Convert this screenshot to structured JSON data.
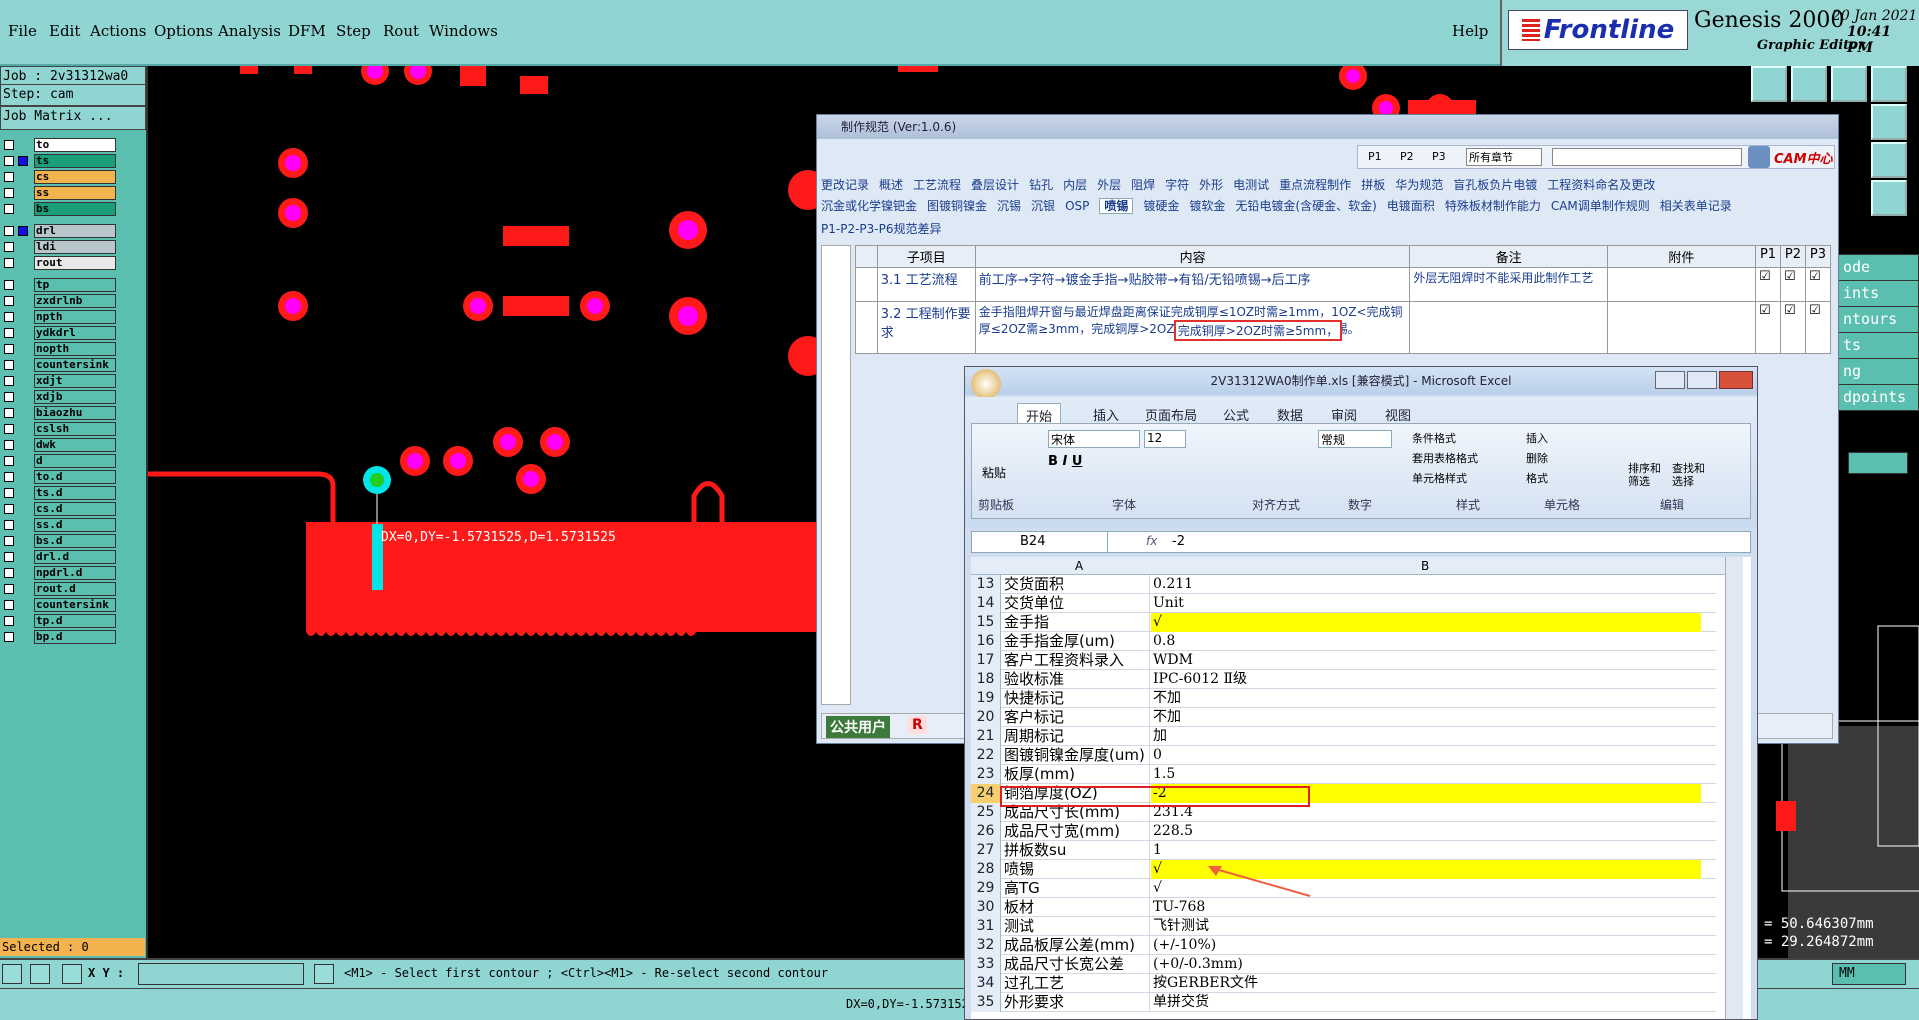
{
  "menu": {
    "items": [
      "File",
      "Edit",
      "Actions",
      "Options",
      "Analysis",
      "DFM",
      "Step",
      "Rout",
      "Windows"
    ],
    "help": "Help"
  },
  "brand": {
    "logo": "Frontline",
    "product": "Genesis 2000",
    "subtitle": "Graphic Editor",
    "date": "20 Jan 2021",
    "time": "10:41 PM"
  },
  "left": {
    "job": "Job : 2v31312wa0",
    "step": "Step: cam",
    "matrix": "Job Matrix ...",
    "layers": [
      {
        "name": "to",
        "color": "#ffffff",
        "marked": false
      },
      {
        "name": "ts",
        "color": "#1a9f7a",
        "marked": true
      },
      {
        "name": "cs",
        "color": "#f2b24e",
        "marked": false
      },
      {
        "name": "ss",
        "color": "#f2b24e",
        "marked": false
      },
      {
        "name": "bs",
        "color": "#1a9f7a",
        "marked": false
      },
      {
        "name": "drl",
        "color": "#b8c6cc",
        "marked": true
      },
      {
        "name": "ldi",
        "color": "#b8c6cc",
        "marked": false
      },
      {
        "name": "rout",
        "color": "#e8e8e8",
        "marked": false
      },
      {
        "name": "tp",
        "color": "#5bbfb0",
        "marked": false
      },
      {
        "name": "zxdrlnb",
        "color": "#5bbfb0",
        "marked": false
      },
      {
        "name": "npth",
        "color": "#5bbfb0",
        "marked": false
      },
      {
        "name": "ydkdrl",
        "color": "#5bbfb0",
        "marked": false
      },
      {
        "name": "nopth",
        "color": "#5bbfb0",
        "marked": false
      },
      {
        "name": "countersink",
        "color": "#5bbfb0",
        "marked": false
      },
      {
        "name": "xdjt",
        "color": "#5bbfb0",
        "marked": false
      },
      {
        "name": "xdjb",
        "color": "#5bbfb0",
        "marked": false
      },
      {
        "name": "biaozhu",
        "color": "#5bbfb0",
        "marked": false
      },
      {
        "name": "cslsh",
        "color": "#5bbfb0",
        "marked": false
      },
      {
        "name": "dwk",
        "color": "#5bbfb0",
        "marked": false
      },
      {
        "name": "d",
        "color": "#5bbfb0",
        "marked": false
      },
      {
        "name": "to.d",
        "color": "#5bbfb0",
        "marked": false
      },
      {
        "name": "ts.d",
        "color": "#5bbfb0",
        "marked": false
      },
      {
        "name": "cs.d",
        "color": "#5bbfb0",
        "marked": false
      },
      {
        "name": "ss.d",
        "color": "#5bbfb0",
        "marked": false
      },
      {
        "name": "bs.d",
        "color": "#5bbfb0",
        "marked": false
      },
      {
        "name": "drl.d",
        "color": "#5bbfb0",
        "marked": false
      },
      {
        "name": "npdrl.d",
        "color": "#5bbfb0",
        "marked": false
      },
      {
        "name": "rout.d",
        "color": "#5bbfb0",
        "marked": false
      },
      {
        "name": "countersink",
        "color": "#5bbfb0",
        "marked": false
      },
      {
        "name": "tp.d",
        "color": "#5bbfb0",
        "marked": false
      },
      {
        "name": "bp.d",
        "color": "#5bbfb0",
        "marked": false
      }
    ],
    "selected": "Selected : 0"
  },
  "canvas": {
    "measure": "DX=0,DY=-1.5731525,D=1.5731525"
  },
  "right": {
    "list": [
      "ode",
      "ints",
      "ntours",
      "ts",
      "ng",
      "dpoints"
    ],
    "coord_x": "= 50.646307mm",
    "coord_y": "= 29.264872mm",
    "units": "MM"
  },
  "bottom": {
    "xy_label": "X Y :",
    "hint": "<M1> - Select first contour ; <Ctrl><M1> - Re-select second contour",
    "status": "DX=0,DY=-1.573152"
  },
  "spec": {
    "title": "制作规范 (Ver:1.0.6)",
    "filters": [
      "P1",
      "P2",
      "P3"
    ],
    "section_select": "所有章节",
    "cam_logo": "CAM中心",
    "tabs_row1": [
      "更改记录",
      "概述",
      "工艺流程",
      "叠层设计",
      "钻孔",
      "内层",
      "外层",
      "阻焊",
      "字符",
      "外形",
      "电测试",
      "重点流程制作",
      "拼板",
      "华为规范",
      "盲孔板负片电镀",
      "工程资料命名及更改"
    ],
    "tabs_row2": [
      "沉金或化学镍钯金",
      "图镀铜镍金",
      "沉锡",
      "沉银",
      "OSP",
      "喷锡",
      "镀硬金",
      "镀软金",
      "无铅电镀金(含硬金、软金)",
      "电镀面积",
      "特殊板材制作能力",
      "CAM调单制作规则",
      "相关表单记录"
    ],
    "tabs_row3": "P1-P2-P3-P6规范差异",
    "headers": [
      "子项目",
      "内容",
      "备注",
      "附件",
      "P1",
      "P2",
      "P3"
    ],
    "rows": [
      {
        "item": "3.1 工艺流程",
        "content": "前工序→字符→镀金手指→贴胶带→有铅/无铅喷锡→后工序",
        "note": "外层无阻焊时不能采用此制作工艺"
      },
      {
        "item": "3.2 工程制作要求",
        "content": "金手指阻焊开窗与最近焊盘距离保证完成铜厚≤1OZ时需≥1mm，1OZ<完成铜厚≤2OZ需≥3mm，完成铜厚>2OZ时需≥5mm，以防止金手指上锡。",
        "highlight": "完成铜厚>2OZ时需≥5mm，",
        "note": ""
      }
    ],
    "user": "公共用户",
    "user_tag": "R"
  },
  "excel": {
    "title": "2V31312WA0制作单.xls  [兼容模式] - Microsoft Excel",
    "tabs": [
      "开始",
      "插入",
      "页面布局",
      "公式",
      "数据",
      "审阅",
      "视图"
    ],
    "font": "宋体",
    "size": "12",
    "numfmt": "常规",
    "groups": [
      "剪贴板",
      "字体",
      "对齐方式",
      "数字",
      "样式",
      "单元格",
      "编辑"
    ],
    "buttons": {
      "paste": "粘贴",
      "cond": "条件格式",
      "table": "套用表格格式",
      "cellstyle": "单元格样式",
      "insert": "插入",
      "delete": "删除",
      "format": "格式",
      "sort": "排序和\n筛选",
      "find": "查找和\n选择"
    },
    "cellref": "B24",
    "formula": "-2",
    "col_a": "A",
    "col_b": "B",
    "rows": [
      {
        "n": "13",
        "a": "交货面积",
        "b": "0.211",
        "y": false
      },
      {
        "n": "14",
        "a": "交货单位",
        "b": "Unit",
        "y": false
      },
      {
        "n": "15",
        "a": "金手指",
        "b": "√",
        "y": true
      },
      {
        "n": "16",
        "a": "金手指金厚(um)",
        "b": "0.8",
        "y": false
      },
      {
        "n": "17",
        "a": "客户工程资料录入",
        "b": "WDM",
        "y": false
      },
      {
        "n": "18",
        "a": "验收标准",
        "b": "IPC-6012 Ⅱ级",
        "y": false
      },
      {
        "n": "19",
        "a": "快捷标记",
        "b": "不加",
        "y": false
      },
      {
        "n": "20",
        "a": "客户标记",
        "b": "不加",
        "y": false
      },
      {
        "n": "21",
        "a": "周期标记",
        "b": "加",
        "y": false
      },
      {
        "n": "22",
        "a": "图镀铜镍金厚度(um)",
        "b": "0",
        "y": false
      },
      {
        "n": "23",
        "a": "板厚(mm)",
        "b": "1.5",
        "y": false
      },
      {
        "n": "24",
        "a": "铜箔厚度(OZ)",
        "b": "-2",
        "y": true
      },
      {
        "n": "25",
        "a": "成品尺寸长(mm)",
        "b": "231.4",
        "y": false
      },
      {
        "n": "26",
        "a": "成品尺寸宽(mm)",
        "b": "228.5",
        "y": false
      },
      {
        "n": "27",
        "a": "拼板数su",
        "b": "1",
        "y": false
      },
      {
        "n": "28",
        "a": "喷锡",
        "b": "√",
        "y": true
      },
      {
        "n": "29",
        "a": "高TG",
        "b": "√",
        "y": false
      },
      {
        "n": "30",
        "a": "板材",
        "b": "TU-768",
        "y": false
      },
      {
        "n": "31",
        "a": "测试",
        "b": "飞针测试",
        "y": false
      },
      {
        "n": "32",
        "a": "成品板厚公差(mm)",
        "b": "(+/-10%)",
        "y": false
      },
      {
        "n": "33",
        "a": "成品尺寸长宽公差",
        "b": "(+0/-0.3mm)",
        "y": false
      },
      {
        "n": "34",
        "a": "过孔工艺",
        "b": "按GERBER文件",
        "y": false
      },
      {
        "n": "35",
        "a": "外形要求",
        "b": "单拼交货",
        "y": false
      }
    ]
  }
}
